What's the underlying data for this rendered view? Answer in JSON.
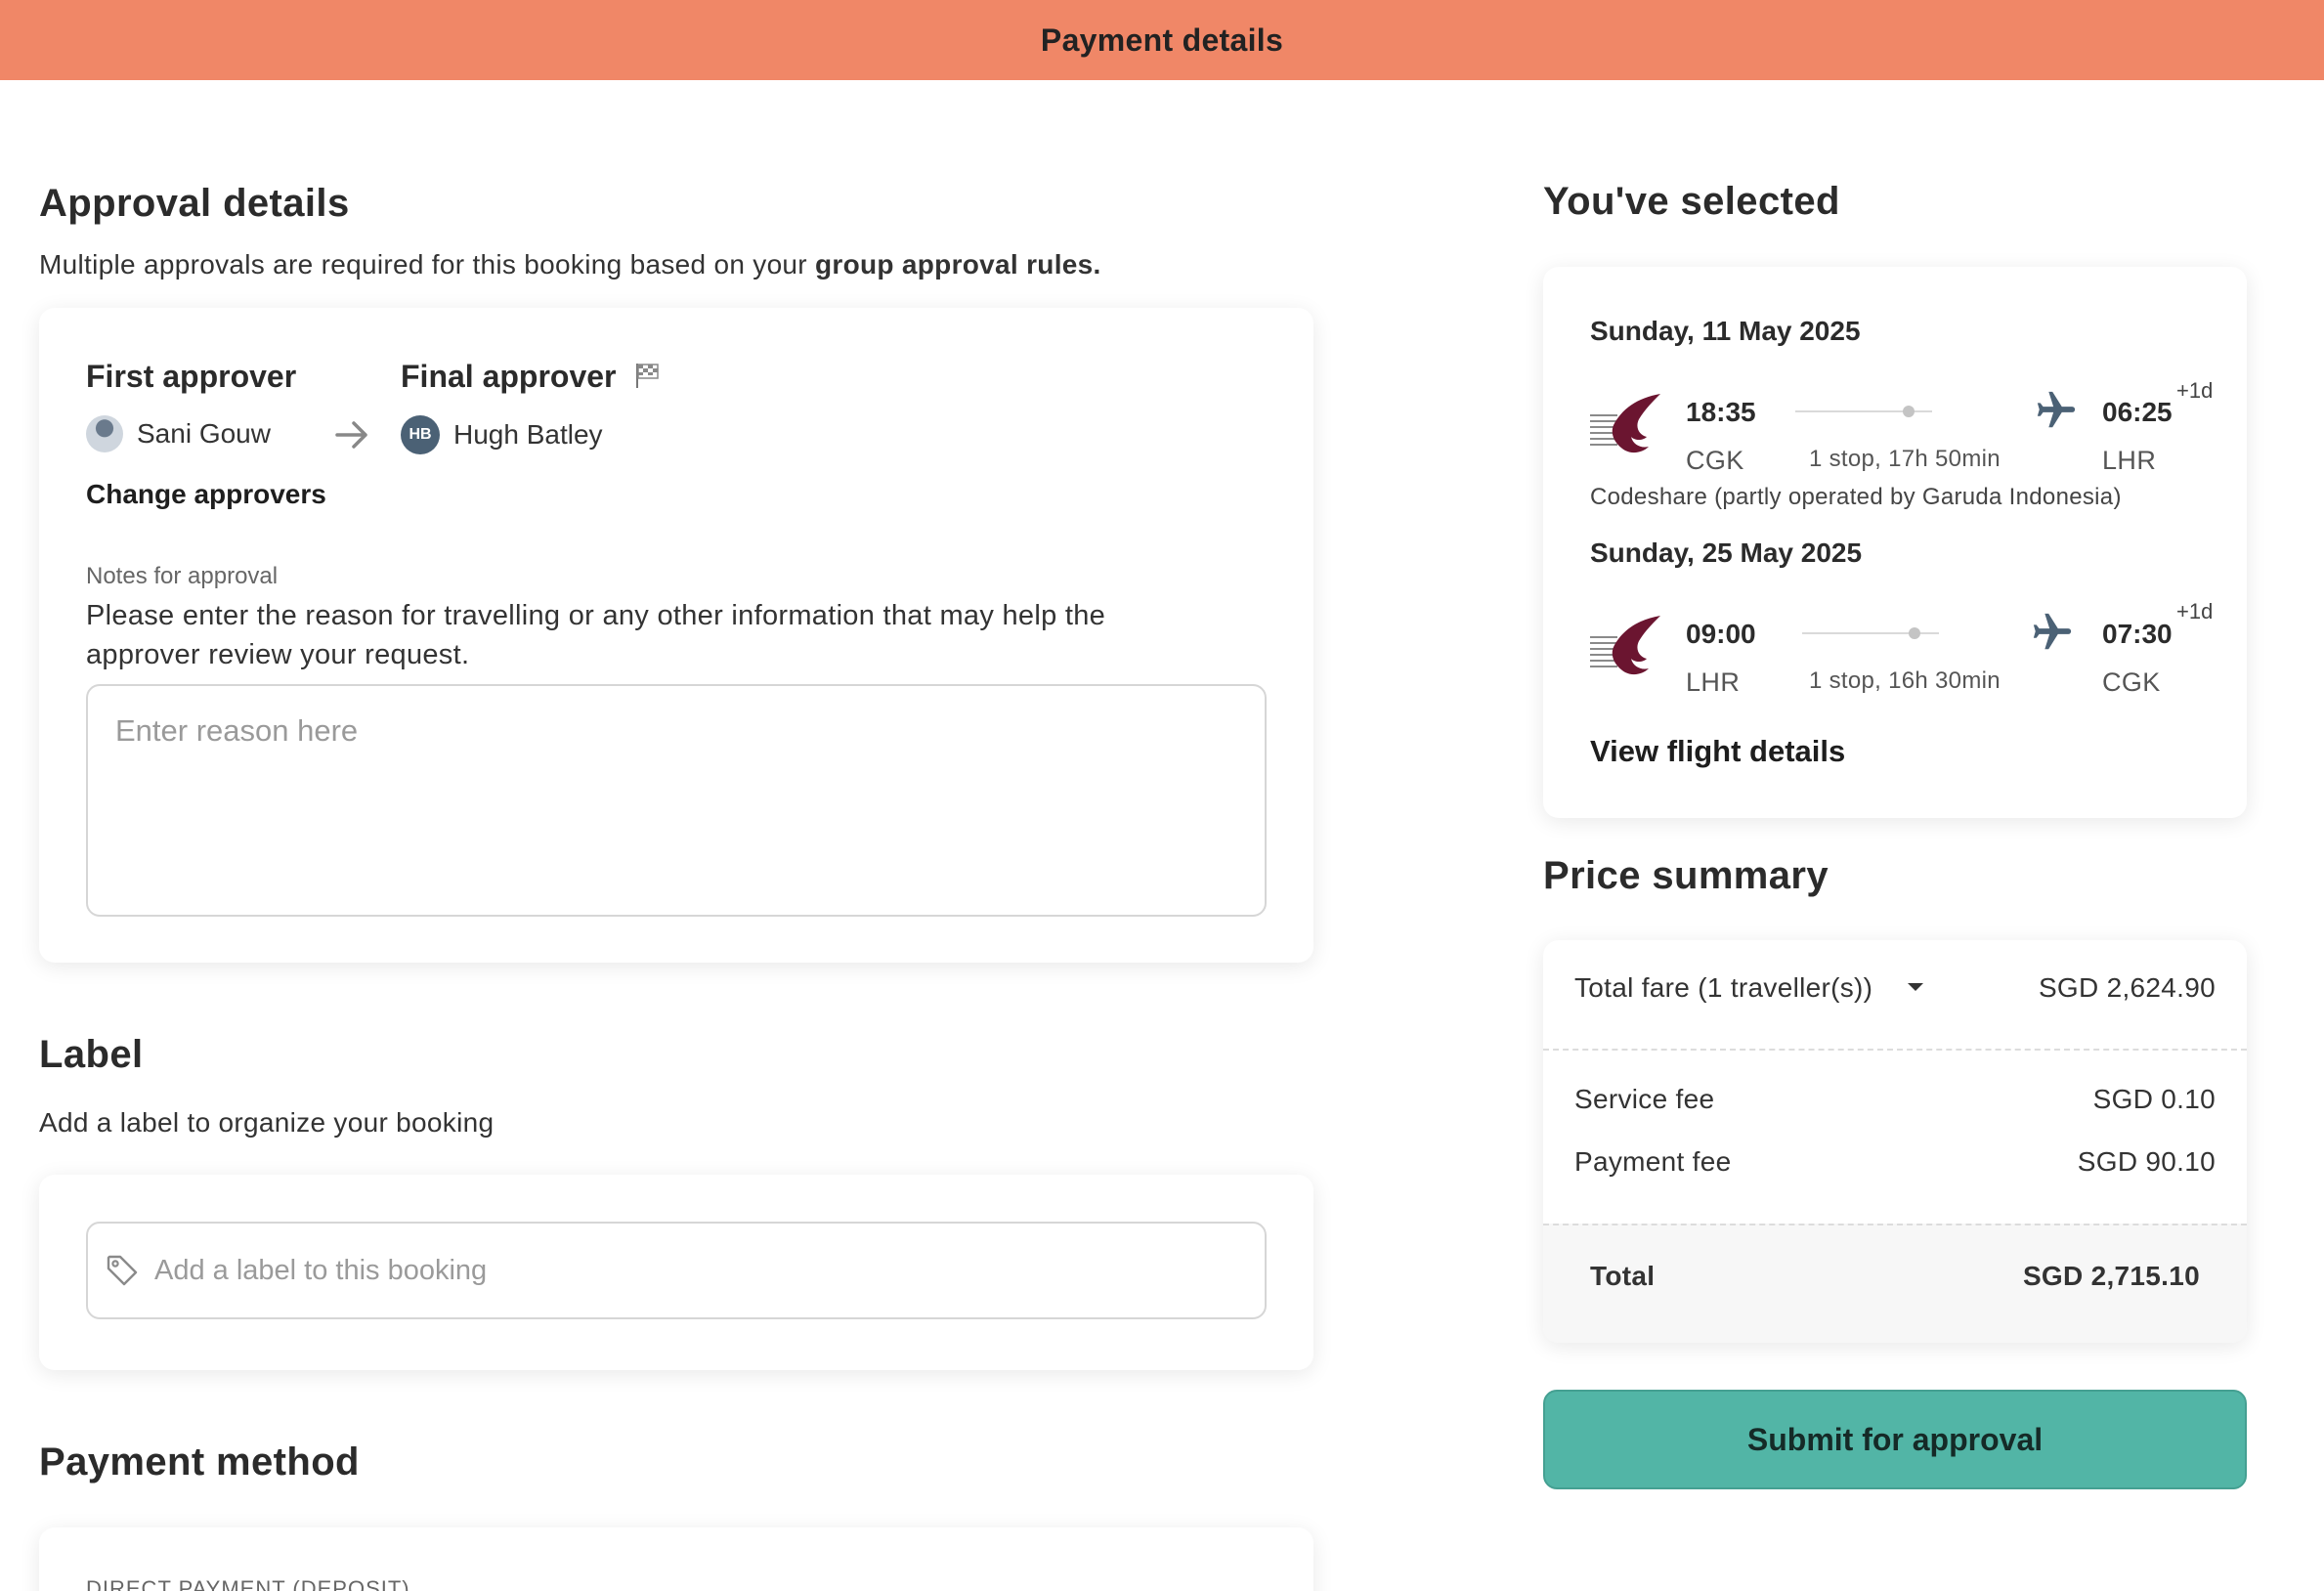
{
  "header": {
    "title": "Payment details"
  },
  "approval": {
    "title": "Approval details",
    "subtitle_prefix": "Multiple approvals are required for this booking based on your ",
    "subtitle_bold": "group approval rules.",
    "first_label": "First approver",
    "first_name": "Sani Gouw",
    "final_label": "Final approver",
    "final_initials": "HB",
    "final_name": "Hugh Batley",
    "change_link": "Change approvers",
    "notes_label": "Notes for approval",
    "notes_line1": "Please enter the reason for travelling or any other information that may help the",
    "notes_line2": "approver review your request.",
    "reason_placeholder": "Enter reason here"
  },
  "label": {
    "title": "Label",
    "subtitle": "Add a label to organize your booking",
    "placeholder": "Add a label to this booking"
  },
  "payment": {
    "title": "Payment method",
    "section": "DIRECT PAYMENT (DEPOSIT)"
  },
  "selected": {
    "title": "You've selected",
    "outbound": {
      "date": "Sunday, 11 May 2025",
      "depart_time": "18:35",
      "depart_code": "CGK",
      "arrive_time": "06:25",
      "arrive_code": "LHR",
      "day_offset": "+1d",
      "stops": "1 stop, 17h 50min",
      "codeshare": "Codeshare (partly operated by Garuda Indonesia)"
    },
    "inbound": {
      "date": "Sunday, 25 May 2025",
      "depart_time": "09:00",
      "depart_code": "LHR",
      "arrive_time": "07:30",
      "arrive_code": "CGK",
      "day_offset": "+1d",
      "stops": "1 stop, 16h 30min"
    },
    "details_link": "View flight details"
  },
  "price": {
    "title": "Price summary",
    "fare_label": "Total fare (1 traveller(s))",
    "fare_value": "SGD 2,624.90",
    "service_label": "Service fee",
    "service_value": "SGD 0.10",
    "payment_label": "Payment fee",
    "payment_value": "SGD 90.10",
    "total_label": "Total",
    "total_value": "SGD 2,715.10"
  },
  "actions": {
    "submit": "Submit for approval"
  },
  "colors": {
    "header": "#f08767",
    "accent": "#52b5a6",
    "avatar": "#4b6175",
    "airline": "#6b1530"
  }
}
